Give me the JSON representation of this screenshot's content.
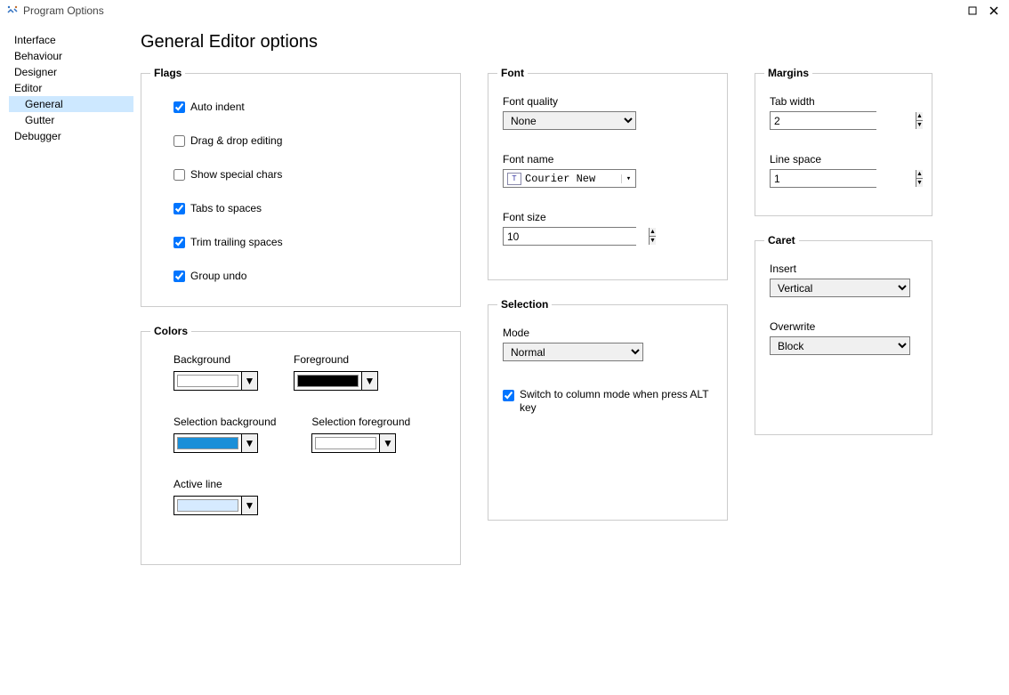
{
  "window": {
    "title": "Program Options"
  },
  "sidebar": {
    "items": [
      {
        "label": "Interface"
      },
      {
        "label": "Behaviour"
      },
      {
        "label": "Designer"
      },
      {
        "label": "Editor"
      },
      {
        "label": "General",
        "child": true,
        "selected": true
      },
      {
        "label": "Gutter",
        "child": true
      },
      {
        "label": "Debugger"
      }
    ]
  },
  "page": {
    "title": "General Editor options"
  },
  "flags": {
    "legend": "Flags",
    "auto_indent": {
      "label": "Auto indent",
      "checked": true
    },
    "drag_drop": {
      "label": "Drag & drop editing",
      "checked": false
    },
    "show_special": {
      "label": "Show special chars",
      "checked": false
    },
    "tabs_spaces": {
      "label": "Tabs to spaces",
      "checked": true
    },
    "trim_trailing": {
      "label": "Trim trailing spaces",
      "checked": true
    },
    "group_undo": {
      "label": "Group undo",
      "checked": true
    }
  },
  "colors": {
    "legend": "Colors",
    "background": {
      "label": "Background",
      "value": "#ffffff"
    },
    "foreground": {
      "label": "Foreground",
      "value": "#000000"
    },
    "sel_bg": {
      "label": "Selection background",
      "value": "#1a8fd8"
    },
    "sel_fg": {
      "label": "Selection foreground",
      "value": "#ffffff"
    },
    "active_line": {
      "label": "Active line",
      "value": "#d6eaff"
    }
  },
  "font": {
    "legend": "Font",
    "quality": {
      "label": "Font quality",
      "value": "None"
    },
    "name": {
      "label": "Font name",
      "value": "Courier New"
    },
    "size": {
      "label": "Font size",
      "value": "10"
    }
  },
  "selection": {
    "legend": "Selection",
    "mode": {
      "label": "Mode",
      "value": "Normal"
    },
    "alt_column": {
      "label": "Switch to column mode when press ALT key",
      "checked": true
    }
  },
  "margins": {
    "legend": "Margins",
    "tab_width": {
      "label": "Tab width",
      "value": "2"
    },
    "line_space": {
      "label": "Line space",
      "value": "1"
    }
  },
  "caret": {
    "legend": "Caret",
    "insert": {
      "label": "Insert",
      "value": "Vertical"
    },
    "overwrite": {
      "label": "Overwrite",
      "value": "Block"
    }
  }
}
